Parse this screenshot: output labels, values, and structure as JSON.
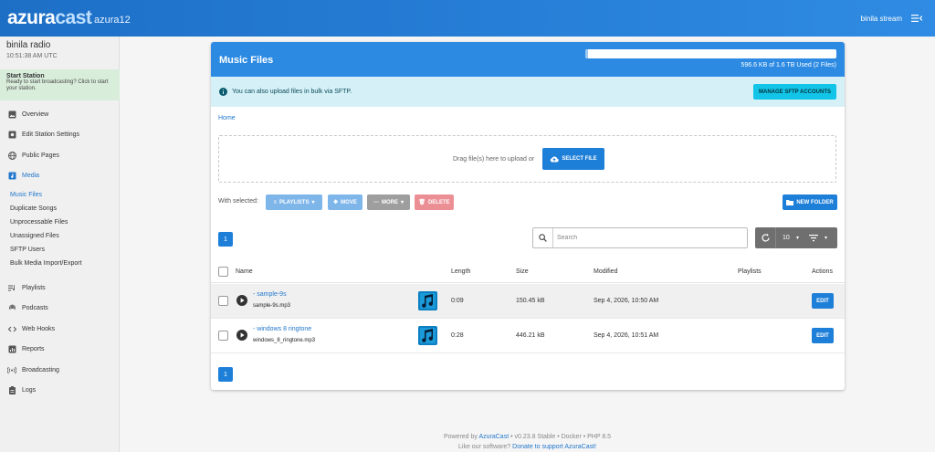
{
  "header": {
    "logo_part1": "azura",
    "logo_part2": "cast",
    "station_tag": "azura12",
    "user_name": "binila stream"
  },
  "sidebar": {
    "station_name": "binila radio",
    "station_time": "10:51:38 AM UTC",
    "start_title": "Start Station",
    "start_desc": "Ready to start broadcasting? Click to start your station.",
    "items": [
      {
        "label": "Overview",
        "icon": "image-icon"
      },
      {
        "label": "Edit Station Settings",
        "icon": "settings-box-icon"
      },
      {
        "label": "Public Pages",
        "icon": "globe-icon"
      },
      {
        "label": "Media",
        "icon": "music-library-icon"
      },
      {
        "label": "Playlists",
        "icon": "queue-music-icon"
      },
      {
        "label": "Podcasts",
        "icon": "podcast-icon"
      },
      {
        "label": "Web Hooks",
        "icon": "code-icon"
      },
      {
        "label": "Reports",
        "icon": "chart-icon"
      },
      {
        "label": "Broadcasting",
        "icon": "broadcast-icon"
      },
      {
        "label": "Logs",
        "icon": "clipboard-icon"
      }
    ],
    "media_sub": [
      "Music Files",
      "Duplicate Songs",
      "Unprocessable Files",
      "Unassigned Files",
      "SFTP Users",
      "Bulk Media Import/Export"
    ]
  },
  "card": {
    "title": "Music Files",
    "quota_text": "596.6 KB of 1.6 TB Used (2 Files)",
    "quota_fraction": 0.004,
    "info_text": "You can also upload files in bulk via SFTP.",
    "sftp_button": "MANAGE SFTP ACCOUNTS",
    "breadcrumb": "Home",
    "drop_text": "Drag file(s) here to upload or",
    "select_file": "SELECT FILE",
    "with_selected": "With selected:",
    "actions": {
      "playlists": "PLAYLISTS",
      "move": "MOVE",
      "more": "MORE",
      "delete": "DELETE",
      "new_folder": "NEW FOLDER"
    },
    "page": "1",
    "search_placeholder": "Search",
    "per_page": "10",
    "columns": [
      "Name",
      "Length",
      "Size",
      "Modified",
      "Playlists",
      "Actions"
    ],
    "rows": [
      {
        "title": "- sample-9s",
        "file": "sample-9s.mp3",
        "length": "0:09",
        "size": "150.45 kB",
        "modified": "Sep 4, 2026, 10:50 AM",
        "playlists": "",
        "action": "EDIT"
      },
      {
        "title": "- windows 8 ringtone",
        "file": "windows_8_ringtone.mp3",
        "length": "0:28",
        "size": "446.21 kB",
        "modified": "Sep 4, 2026, 10:51 AM",
        "playlists": "",
        "action": "EDIT"
      }
    ]
  },
  "footer": {
    "powered_prefix": "Powered by",
    "powered_link": "AzuraCast",
    "powered_suffix": "• v0.23.8 Stable • Docker • PHP 8.5",
    "like_text": "Like our software?",
    "donate_link": "Donate to support AzuraCast!"
  },
  "colors": {
    "primary": "#2d8ae3",
    "info_bg": "#d5f1f7",
    "sftp_button": "#12c5e8",
    "delete": "#ec8f95",
    "start_box": "#d9eddb"
  }
}
